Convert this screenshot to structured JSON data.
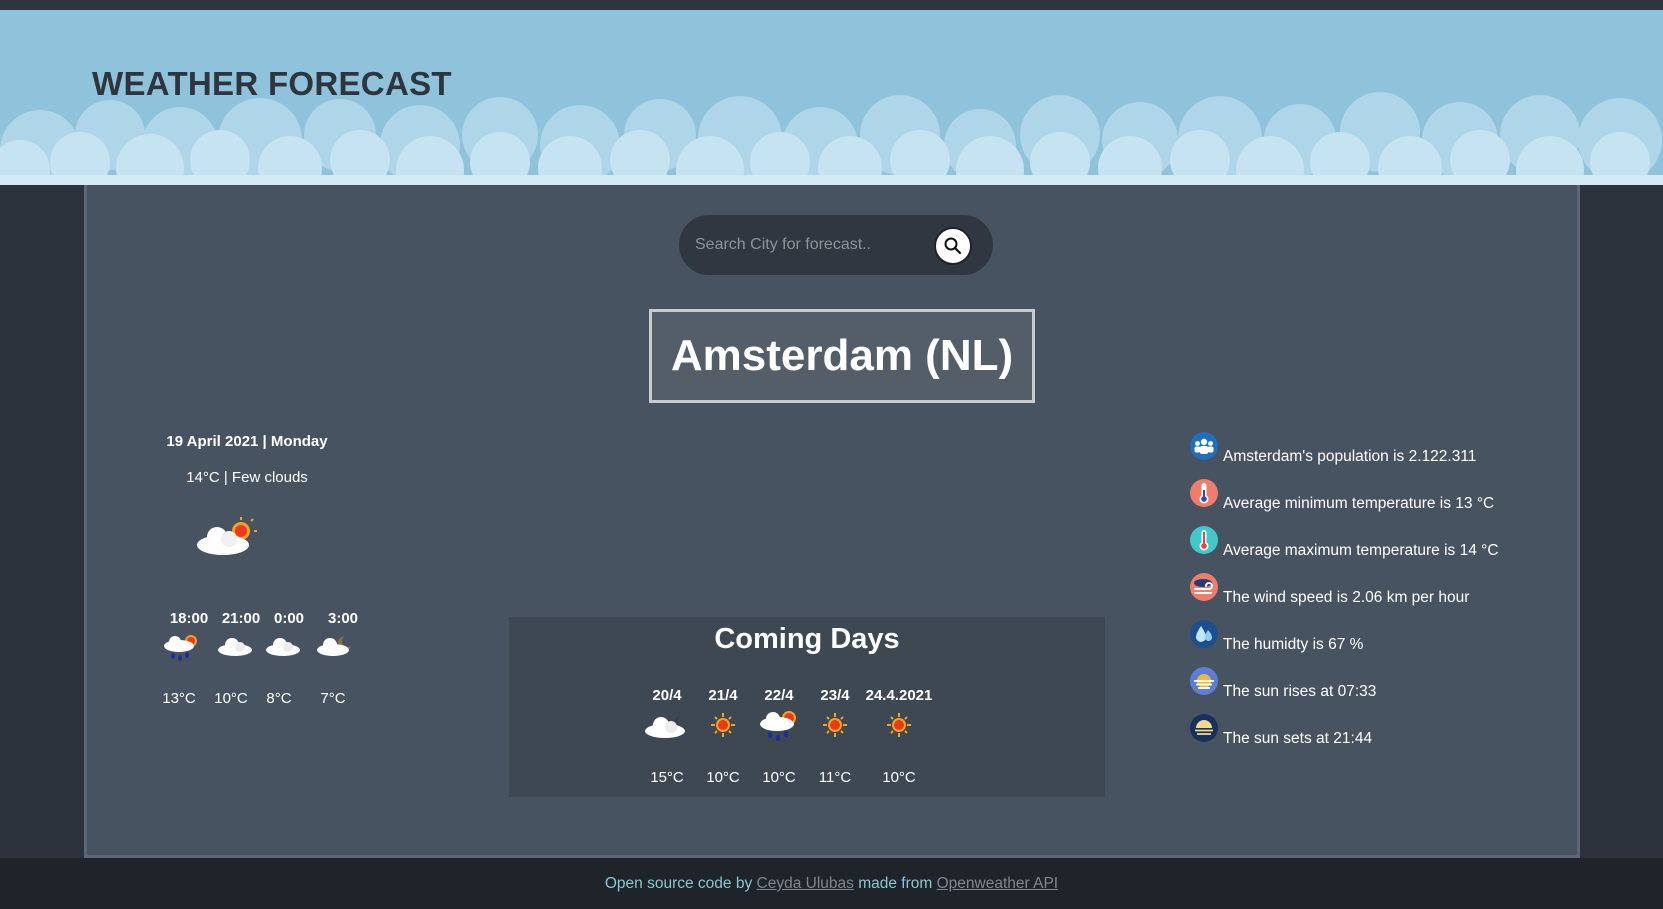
{
  "header": {
    "title": "WEATHER FORECAST"
  },
  "search": {
    "placeholder": "Search City for forecast.."
  },
  "city": {
    "name": "Amsterdam (NL)"
  },
  "today": {
    "date": "19 April 2021 | Monday",
    "description": "14°C | Few clouds",
    "icon": "sun-behind-cloud-icon"
  },
  "hourly": [
    {
      "time": "18:00",
      "temp": "13°C",
      "icon": "rain-sun-cloud-icon"
    },
    {
      "time": "21:00",
      "temp": "10°C",
      "icon": "cloud-icon"
    },
    {
      "time": "0:00",
      "temp": "8°C",
      "icon": "cloud-icon"
    },
    {
      "time": "3:00",
      "temp": "7°C",
      "icon": "cloud-moon-icon"
    }
  ],
  "coming": {
    "title": "Coming Days",
    "days": [
      {
        "date": "20/4",
        "temp": "15°C",
        "icon": "cloud-moon-icon"
      },
      {
        "date": "21/4",
        "temp": "10°C",
        "icon": "sun-icon"
      },
      {
        "date": "22/4",
        "temp": "10°C",
        "icon": "rain-sun-cloud-icon"
      },
      {
        "date": "23/4",
        "temp": "11°C",
        "icon": "sun-icon"
      },
      {
        "date": "24.4.2021",
        "temp": "10°C",
        "icon": "sun-icon"
      }
    ]
  },
  "facts": [
    {
      "text": "Amsterdam's population is 2.122.311",
      "icon": "population-icon",
      "color": "#1f6fbf"
    },
    {
      "text": "Average minimum temperature is 13 °C",
      "icon": "thermometer-low-icon",
      "color": "#f07c6c"
    },
    {
      "text": "Average maximum temperature is 14 °C",
      "icon": "thermometer-high-icon",
      "color": "#3fc9c9"
    },
    {
      "text": "The wind speed is 2.06 km per hour",
      "icon": "wind-icon",
      "color": "#f07c6c"
    },
    {
      "text": "The humidty is 67 %",
      "icon": "humidity-icon",
      "color": "#1d4f8f"
    },
    {
      "text": "The sun rises at 07:33",
      "icon": "sunrise-icon",
      "color": "#5b7fd6"
    },
    {
      "text": "The sun sets at 21:44",
      "icon": "sunset-icon",
      "color": "#16315e"
    }
  ],
  "footer": {
    "prefix": "Open source code by",
    "author": "Ceyda Ulubas",
    "middle": "made from",
    "api": "Openweather API"
  }
}
